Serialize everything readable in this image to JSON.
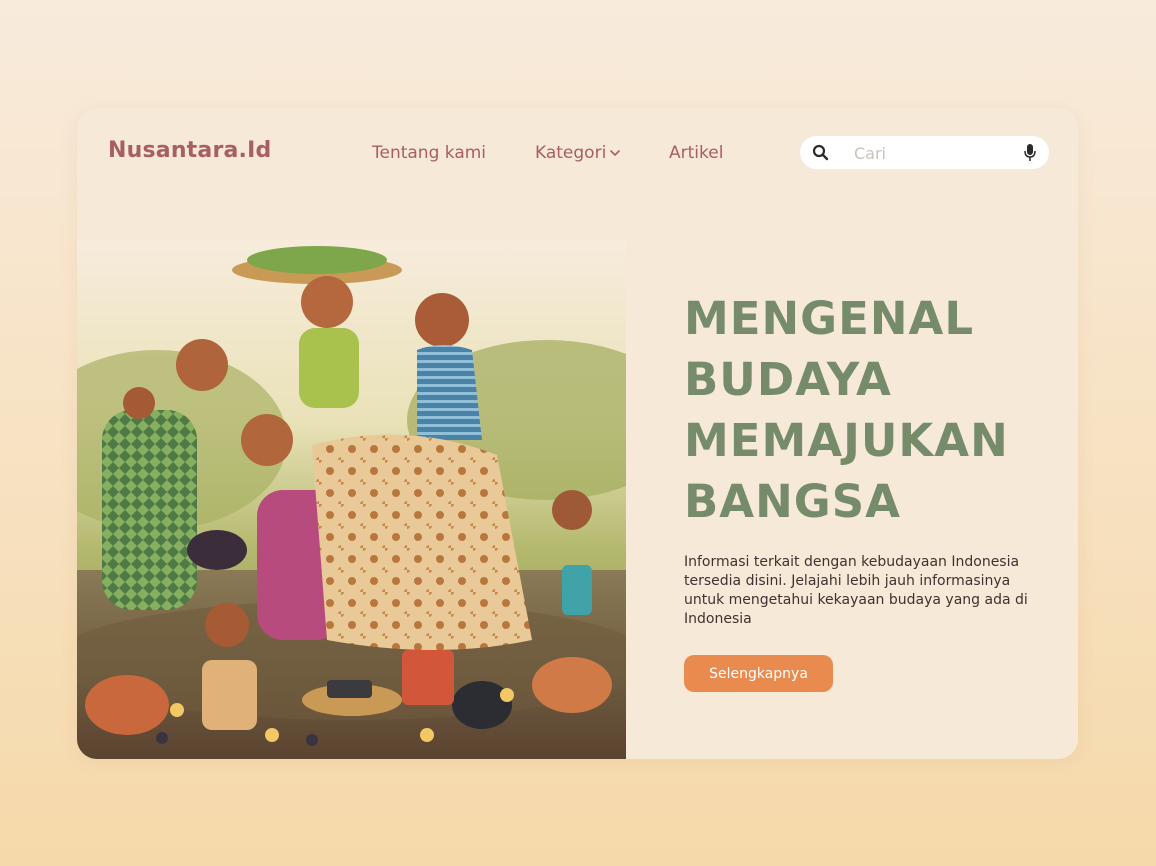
{
  "brand": {
    "name": "Nusantara.Id"
  },
  "nav": {
    "items": [
      {
        "label": "Tentang kami"
      },
      {
        "label": "Kategori"
      },
      {
        "label": "Artikel"
      }
    ]
  },
  "search": {
    "placeholder": "Cari",
    "value": ""
  },
  "hero": {
    "headline": [
      "MENGENAL",
      "BUDAYA",
      "MEMAJUKAN",
      "BANGSA"
    ],
    "description": "Informasi terkait dengan kebudayaan Indonesia tersedia disini. Jelajahi lebih jauh informasinya untuk mengetahui kekayaan budaya yang ada di Indonesia",
    "cta_label": "Selengkapnya"
  },
  "colors": {
    "brand": "#a85e66",
    "headline": "#768b6a",
    "cta": "#e98a4f",
    "card": "#f7e9d7"
  }
}
